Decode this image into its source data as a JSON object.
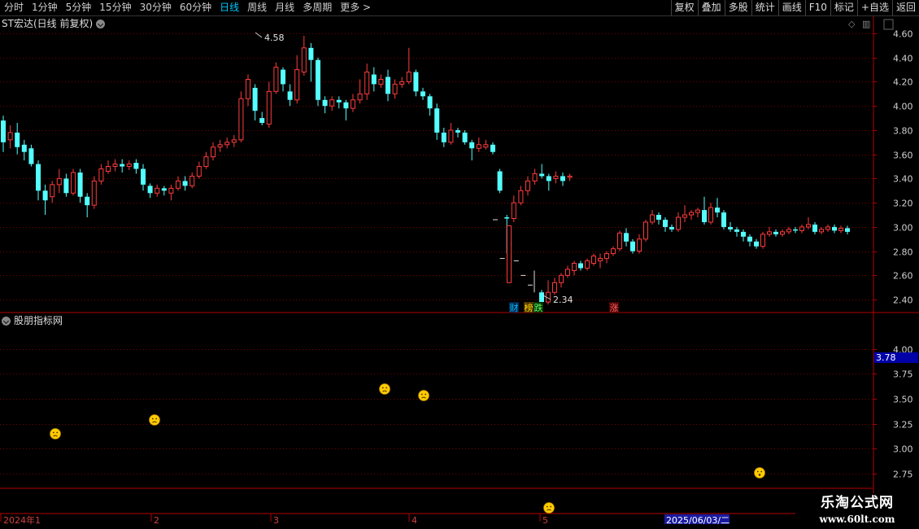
{
  "toolbar": {
    "periods": [
      "分时",
      "1分钟",
      "5分钟",
      "15分钟",
      "30分钟",
      "60分钟",
      "日线",
      "周线",
      "月线",
      "多周期",
      "更多 >"
    ],
    "active_period": "日线",
    "buttons": [
      "复权",
      "叠加",
      "多股",
      "统计",
      "画线",
      "F10",
      "标记",
      "+自选",
      "返回"
    ]
  },
  "chart": {
    "title": "ST宏达(日线 前复权)",
    "high_label": "4.58",
    "low_label": "2.34",
    "price_axis": [
      "4.60",
      "4.40",
      "4.20",
      "4.00",
      "3.80",
      "3.60",
      "3.40",
      "3.20",
      "3.00",
      "2.80",
      "2.60",
      "2.40"
    ],
    "markers": [
      {
        "text": "财",
        "color": "#00bfff",
        "bg": "#00264d"
      },
      {
        "text": "榜",
        "color": "#ffd700",
        "bg": "#4d3300"
      },
      {
        "text": "跌",
        "color": "#66ff66",
        "bg": "#003300"
      },
      {
        "text": "涨",
        "color": "#ff6666",
        "bg": "#4d0000"
      }
    ],
    "colors": {
      "up": "#ff3b3b",
      "down": "#54ffff",
      "grid": "#7a0000",
      "axis": "#b40000"
    }
  },
  "chart_data": {
    "type": "candlestick",
    "title": "ST宏达(日线 前复权)",
    "y_range": [
      2.3,
      4.62
    ],
    "high": 4.58,
    "low": 2.34,
    "candles": [
      [
        3.88,
        3.7,
        3.92,
        3.62
      ],
      [
        3.72,
        3.78,
        3.84,
        3.65
      ],
      [
        3.78,
        3.66,
        3.86,
        3.6
      ],
      [
        3.68,
        3.62,
        3.72,
        3.55
      ],
      [
        3.65,
        3.52,
        3.68,
        3.5
      ],
      [
        3.52,
        3.3,
        3.55,
        3.22
      ],
      [
        3.3,
        3.22,
        3.35,
        3.1
      ],
      [
        3.25,
        3.35,
        3.38,
        3.2
      ],
      [
        3.35,
        3.4,
        3.48,
        3.28
      ],
      [
        3.4,
        3.28,
        3.44,
        3.25
      ],
      [
        3.28,
        3.45,
        3.48,
        3.26
      ],
      [
        3.45,
        3.25,
        3.48,
        3.2
      ],
      [
        3.25,
        3.18,
        3.28,
        3.08
      ],
      [
        3.18,
        3.38,
        3.42,
        3.15
      ],
      [
        3.38,
        3.48,
        3.52,
        3.35
      ],
      [
        3.46,
        3.5,
        3.55,
        3.44
      ],
      [
        3.5,
        3.52,
        3.56,
        3.46
      ],
      [
        3.52,
        3.5,
        3.56,
        3.45
      ],
      [
        3.5,
        3.52,
        3.55,
        3.47
      ],
      [
        3.53,
        3.48,
        3.56,
        3.44
      ],
      [
        3.48,
        3.35,
        3.52,
        3.3
      ],
      [
        3.34,
        3.28,
        3.36,
        3.24
      ],
      [
        3.28,
        3.32,
        3.35,
        3.25
      ],
      [
        3.32,
        3.3,
        3.34,
        3.26
      ],
      [
        3.28,
        3.32,
        3.35,
        3.22
      ],
      [
        3.32,
        3.38,
        3.42,
        3.3
      ],
      [
        3.38,
        3.34,
        3.42,
        3.3
      ],
      [
        3.34,
        3.42,
        3.45,
        3.32
      ],
      [
        3.42,
        3.5,
        3.54,
        3.4
      ],
      [
        3.5,
        3.58,
        3.62,
        3.48
      ],
      [
        3.58,
        3.66,
        3.7,
        3.55
      ],
      [
        3.66,
        3.68,
        3.72,
        3.62
      ],
      [
        3.68,
        3.7,
        3.74,
        3.65
      ],
      [
        3.7,
        3.72,
        3.76,
        3.66
      ],
      [
        3.72,
        4.06,
        4.12,
        3.7
      ],
      [
        4.06,
        4.22,
        4.26,
        4.0
      ],
      [
        4.15,
        3.96,
        4.18,
        3.88
      ],
      [
        3.9,
        3.86,
        3.95,
        3.84
      ],
      [
        3.85,
        4.12,
        4.2,
        3.82
      ],
      [
        4.12,
        4.32,
        4.36,
        4.1
      ],
      [
        4.3,
        4.18,
        4.32,
        4.12
      ],
      [
        4.12,
        4.05,
        4.18,
        4.0
      ],
      [
        4.05,
        4.3,
        4.42,
        4.02
      ],
      [
        4.28,
        4.48,
        4.58,
        4.25
      ],
      [
        4.48,
        4.38,
        4.52,
        4.2
      ],
      [
        4.38,
        4.05,
        4.4,
        4.0
      ],
      [
        4.05,
        4.0,
        4.08,
        3.94
      ],
      [
        4.0,
        4.05,
        4.08,
        3.96
      ],
      [
        4.05,
        4.03,
        4.08,
        3.98
      ],
      [
        4.03,
        3.98,
        4.05,
        3.88
      ],
      [
        3.98,
        4.05,
        4.1,
        3.95
      ],
      [
        4.05,
        4.1,
        4.22,
        4.02
      ],
      [
        4.1,
        4.28,
        4.35,
        4.05
      ],
      [
        4.26,
        4.18,
        4.32,
        4.12
      ],
      [
        4.18,
        4.22,
        4.26,
        4.15
      ],
      [
        4.24,
        4.1,
        4.3,
        4.04
      ],
      [
        4.1,
        4.18,
        4.22,
        4.06
      ],
      [
        4.18,
        4.2,
        4.24,
        4.15
      ],
      [
        4.2,
        4.28,
        4.48,
        4.18
      ],
      [
        4.28,
        4.12,
        4.3,
        4.08
      ],
      [
        4.12,
        4.08,
        4.15,
        4.05
      ],
      [
        4.08,
        3.98,
        4.1,
        3.92
      ],
      [
        3.98,
        3.78,
        4.02,
        3.72
      ],
      [
        3.78,
        3.7,
        3.82,
        3.66
      ],
      [
        3.7,
        3.8,
        3.86,
        3.68
      ],
      [
        3.8,
        3.78,
        3.82,
        3.74
      ],
      [
        3.78,
        3.7,
        3.8,
        3.68
      ],
      [
        3.7,
        3.65,
        3.72,
        3.55
      ],
      [
        3.65,
        3.68,
        3.74,
        3.62
      ],
      [
        3.66,
        3.68,
        3.72,
        3.64
      ],
      [
        3.68,
        3.62,
        3.7,
        3.6
      ],
      [
        3.46,
        3.3,
        3.48,
        3.28
      ],
      [
        3.08,
        3.07,
        3.1,
        2.78
      ],
      [
        3.07,
        3.2,
        3.26,
        3.04
      ],
      [
        3.2,
        3.3,
        3.34,
        3.18
      ],
      [
        3.3,
        3.38,
        3.42,
        3.26
      ],
      [
        3.38,
        3.44,
        3.48,
        3.35
      ],
      [
        3.44,
        3.42,
        3.52,
        3.4
      ],
      [
        3.42,
        3.38,
        3.44,
        3.3
      ],
      [
        3.4,
        3.42,
        3.46,
        3.36
      ],
      [
        3.42,
        3.38,
        3.45,
        3.34
      ],
      [
        3.41,
        3.42,
        3.44,
        3.38
      ]
    ],
    "gap_ticks": [
      3.06,
      2.74,
      2.86,
      2.72,
      2.6,
      2.52
    ],
    "limit_down": {
      "open": 3.01,
      "close": 2.54
    },
    "candles2": [
      [
        2.46,
        2.38,
        2.48,
        2.34
      ],
      [
        2.38,
        2.46,
        2.56,
        2.36
      ],
      [
        2.46,
        2.54,
        2.58,
        2.44
      ],
      [
        2.54,
        2.6,
        2.62,
        2.5
      ],
      [
        2.6,
        2.65,
        2.68,
        2.58
      ],
      [
        2.64,
        2.7,
        2.72,
        2.6
      ],
      [
        2.7,
        2.66,
        2.72,
        2.64
      ],
      [
        2.66,
        2.72,
        2.74,
        2.64
      ],
      [
        2.7,
        2.76,
        2.78,
        2.68
      ],
      [
        2.72,
        2.74,
        2.78,
        2.66
      ],
      [
        2.74,
        2.78,
        2.8,
        2.7
      ],
      [
        2.78,
        2.82,
        2.84,
        2.76
      ],
      [
        2.82,
        2.95,
        2.97,
        2.8
      ],
      [
        2.95,
        2.88,
        2.99,
        2.84
      ],
      [
        2.88,
        2.8,
        2.9,
        2.78
      ],
      [
        2.8,
        2.9,
        2.94,
        2.78
      ],
      [
        2.9,
        3.04,
        3.06,
        2.88
      ],
      [
        3.04,
        3.1,
        3.14,
        3.02
      ],
      [
        3.1,
        3.06,
        3.12,
        3.02
      ],
      [
        3.06,
        3.0,
        3.08,
        2.96
      ],
      [
        3.0,
        2.98,
        3.02,
        2.96
      ],
      [
        2.98,
        3.08,
        3.12,
        2.96
      ],
      [
        3.08,
        3.1,
        3.18,
        3.04
      ],
      [
        3.1,
        3.12,
        3.14,
        3.06
      ],
      [
        3.12,
        3.14,
        3.16,
        3.08
      ],
      [
        3.14,
        3.04,
        3.25,
        3.02
      ],
      [
        3.04,
        3.16,
        3.2,
        3.02
      ],
      [
        3.16,
        3.12,
        3.24,
        3.08
      ],
      [
        3.12,
        3.0,
        3.14,
        2.98
      ],
      [
        3.0,
        2.98,
        3.04,
        2.96
      ],
      [
        2.98,
        2.96,
        3.0,
        2.92
      ],
      [
        2.96,
        2.92,
        2.98,
        2.88
      ],
      [
        2.92,
        2.88,
        2.94,
        2.84
      ],
      [
        2.88,
        2.84,
        2.9,
        2.82
      ],
      [
        2.84,
        2.94,
        2.96,
        2.82
      ],
      [
        2.94,
        2.96,
        3.0,
        2.92
      ],
      [
        2.96,
        2.94,
        2.98,
        2.92
      ],
      [
        2.94,
        2.96,
        2.98,
        2.92
      ],
      [
        2.96,
        2.98,
        3.0,
        2.94
      ],
      [
        2.98,
        2.97,
        3.0,
        2.95
      ],
      [
        2.97,
        3.0,
        3.02,
        2.95
      ],
      [
        3.0,
        3.02,
        3.08,
        2.98
      ],
      [
        3.02,
        2.96,
        3.04,
        2.94
      ],
      [
        2.96,
        2.98,
        3.0,
        2.94
      ],
      [
        2.98,
        3.0,
        3.02,
        2.96
      ],
      [
        3.0,
        2.97,
        3.02,
        2.95
      ],
      [
        2.97,
        2.99,
        3.01,
        2.95
      ],
      [
        2.99,
        2.96,
        3.01,
        2.94
      ]
    ],
    "indicator": {
      "name": "股朋指标网",
      "y_range": [
        2.6,
        4.22
      ],
      "y_ticks": [
        "4.00",
        "3.75",
        "3.50",
        "3.25",
        "3.00",
        "2.75"
      ],
      "current": "3.78",
      "points": [
        {
          "bar": 8,
          "value": 3.08,
          "mood": "sad"
        },
        {
          "bar": 22,
          "value": 3.22,
          "mood": "sad"
        },
        {
          "bar": 55,
          "value": 3.52,
          "mood": "sad"
        },
        {
          "bar": 61,
          "value": 3.48,
          "mood": "sad"
        },
        {
          "bar": 79,
          "value": 2.52,
          "mood": "sad"
        },
        {
          "bar": 110,
          "value": 2.68,
          "mood": "shock"
        }
      ]
    },
    "x_axis": {
      "labels": [
        "2024年1",
        "2",
        "3",
        "4",
        "5"
      ],
      "highlight": "2025/06/03/二"
    }
  },
  "watermark": {
    "line1": "乐淘公式网",
    "line2": "www.60lt.com"
  },
  "icons": {
    "diamond": "diamond-icon",
    "scroll": "scrollbar-icon",
    "toggle": "collapse-toggle-icon"
  }
}
